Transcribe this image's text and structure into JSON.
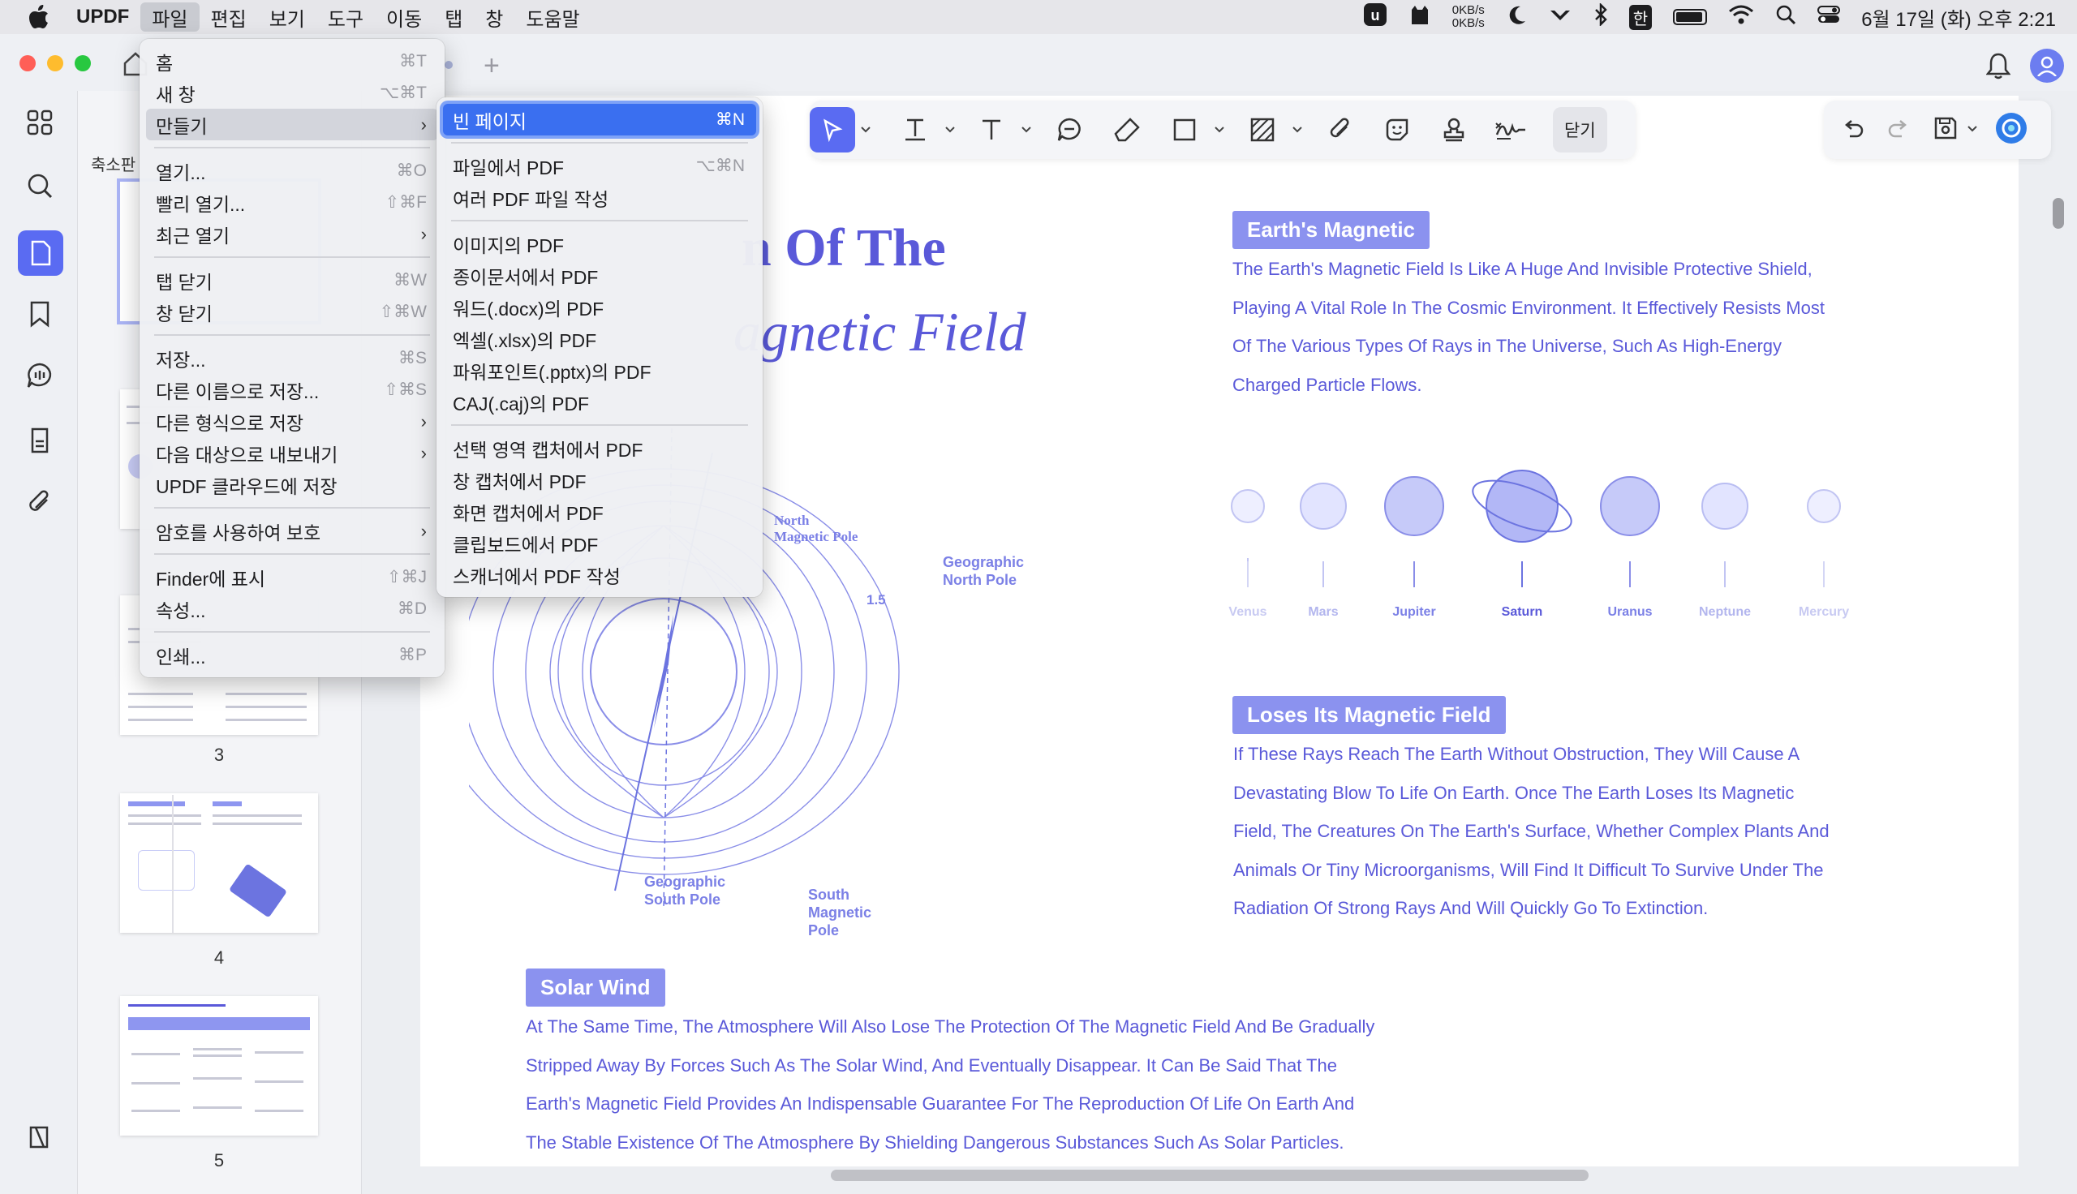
{
  "menubar": {
    "app": "UPDF",
    "items": [
      "파일",
      "편집",
      "보기",
      "도구",
      "이동",
      "탭",
      "창",
      "도움말"
    ],
    "net_up": "0KB/s",
    "net_down": "0KB/s",
    "ime": "한",
    "datetime": "6월 17일 (화) 오후 2:21"
  },
  "sidebar": {
    "title": "축소판",
    "pages": [
      "3",
      "4",
      "5"
    ]
  },
  "toolbar": {
    "close_label": "닫기"
  },
  "file_menu": {
    "items": [
      {
        "label": "홈",
        "shortcut": "⌘T"
      },
      {
        "label": "새 창",
        "shortcut": "⌥⌘T"
      },
      {
        "label": "만들기",
        "submenu": true
      },
      {
        "label": "열기...",
        "shortcut": "⌘O"
      },
      {
        "label": "빨리 열기...",
        "shortcut": "⇧⌘F"
      },
      {
        "label": "최근 열기",
        "submenu": true
      },
      {
        "label": "탭 닫기",
        "shortcut": "⌘W"
      },
      {
        "label": "창 닫기",
        "shortcut": "⇧⌘W"
      },
      {
        "label": "저장...",
        "shortcut": "⌘S"
      },
      {
        "label": "다른 이름으로 저장...",
        "shortcut": "⇧⌘S"
      },
      {
        "label": "다른 형식으로 저장",
        "submenu": true
      },
      {
        "label": "다음 대상으로 내보내기",
        "submenu": true
      },
      {
        "label": "UPDF 클라우드에 저장"
      },
      {
        "label": "암호를 사용하여 보호",
        "submenu": true
      },
      {
        "label": "Finder에 표시",
        "shortcut": "⇧⌘J"
      },
      {
        "label": "속성...",
        "shortcut": "⌘D"
      },
      {
        "label": "인쇄...",
        "shortcut": "⌘P"
      }
    ]
  },
  "create_submenu": {
    "items": [
      {
        "label": "빈 페이지",
        "shortcut": "⌘N"
      },
      {
        "label": "파일에서 PDF",
        "shortcut": "⌥⌘N"
      },
      {
        "label": "여러 PDF 파일 작성"
      },
      {
        "label": "이미지의 PDF"
      },
      {
        "label": "종이문서에서 PDF"
      },
      {
        "label": "워드(.docx)의 PDF"
      },
      {
        "label": "엑셀(.xlsx)의 PDF"
      },
      {
        "label": "파워포인트(.pptx)의 PDF"
      },
      {
        "label": "CAJ(.caj)의 PDF"
      },
      {
        "label": "선택 영역 캡처에서 PDF"
      },
      {
        "label": "창 캡처에서 PDF"
      },
      {
        "label": "화면 캡처에서 PDF"
      },
      {
        "label": "클립보드에서 PDF"
      },
      {
        "label": "스캐너에서 PDF 작성"
      }
    ]
  },
  "document": {
    "title_line1": "n Of The",
    "title_line2": "agnetic Field",
    "section1_heading": "Earth's Magnetic",
    "section1_lines": [
      "The Earth's Magnetic Field Is Like A Huge And Invisible Protective Shield,",
      "Playing A Vital Role In The Cosmic Environment. It Effectively Resists Most",
      "Of The Various Types Of Rays in The Universe, Such As High-Energy",
      "Charged Particle Flows."
    ],
    "planets": [
      "Venus",
      "Mars",
      "Jupiter",
      "Saturn",
      "Uranus",
      "Neptune",
      "Mercury"
    ],
    "section2_heading": "Loses Its Magnetic Field",
    "section2_lines": [
      "If These Rays Reach The Earth Without Obstruction, They Will Cause A",
      "Devastating Blow To Life On Earth. Once The Earth Loses Its Magnetic",
      "Field, The Creatures On The Earth's Surface, Whether Complex Plants And",
      "Animals Or Tiny Microorganisms, Will Find It Difficult To Survive Under The",
      "Radiation Of Strong Rays And Will Quickly Go To Extinction."
    ],
    "section3_heading": "Solar Wind",
    "section3_lines": [
      "At The Same Time, The Atmosphere Will Also Lose The Protection Of The Magnetic Field And Be Gradually",
      "Stripped Away By Forces Such As The Solar Wind, And Eventually Disappear. It Can Be Said That The",
      "Earth's Magnetic Field Provides An Indispensable Guarantee For The Reproduction Of Life On Earth And",
      "The Stable Existence Of The Atmosphere By Shielding Dangerous Substances Such As Solar Particles."
    ],
    "diagram": {
      "north_magnetic_pole": [
        "North",
        "Magnetic Pole"
      ],
      "geographic_north_pole": [
        "Geographic",
        "North Pole"
      ],
      "angle": "1.5",
      "geographic_south_pole": [
        "Geographic",
        "South Pole"
      ],
      "south_magnetic_pole": [
        "South",
        "Magnetic",
        "Pole"
      ]
    }
  },
  "colors": {
    "accent": "#5a6bf2",
    "doc_text": "#5a59d9",
    "pill_bg": "#8b92ef",
    "menu_highlight": "#3a6ff0"
  }
}
